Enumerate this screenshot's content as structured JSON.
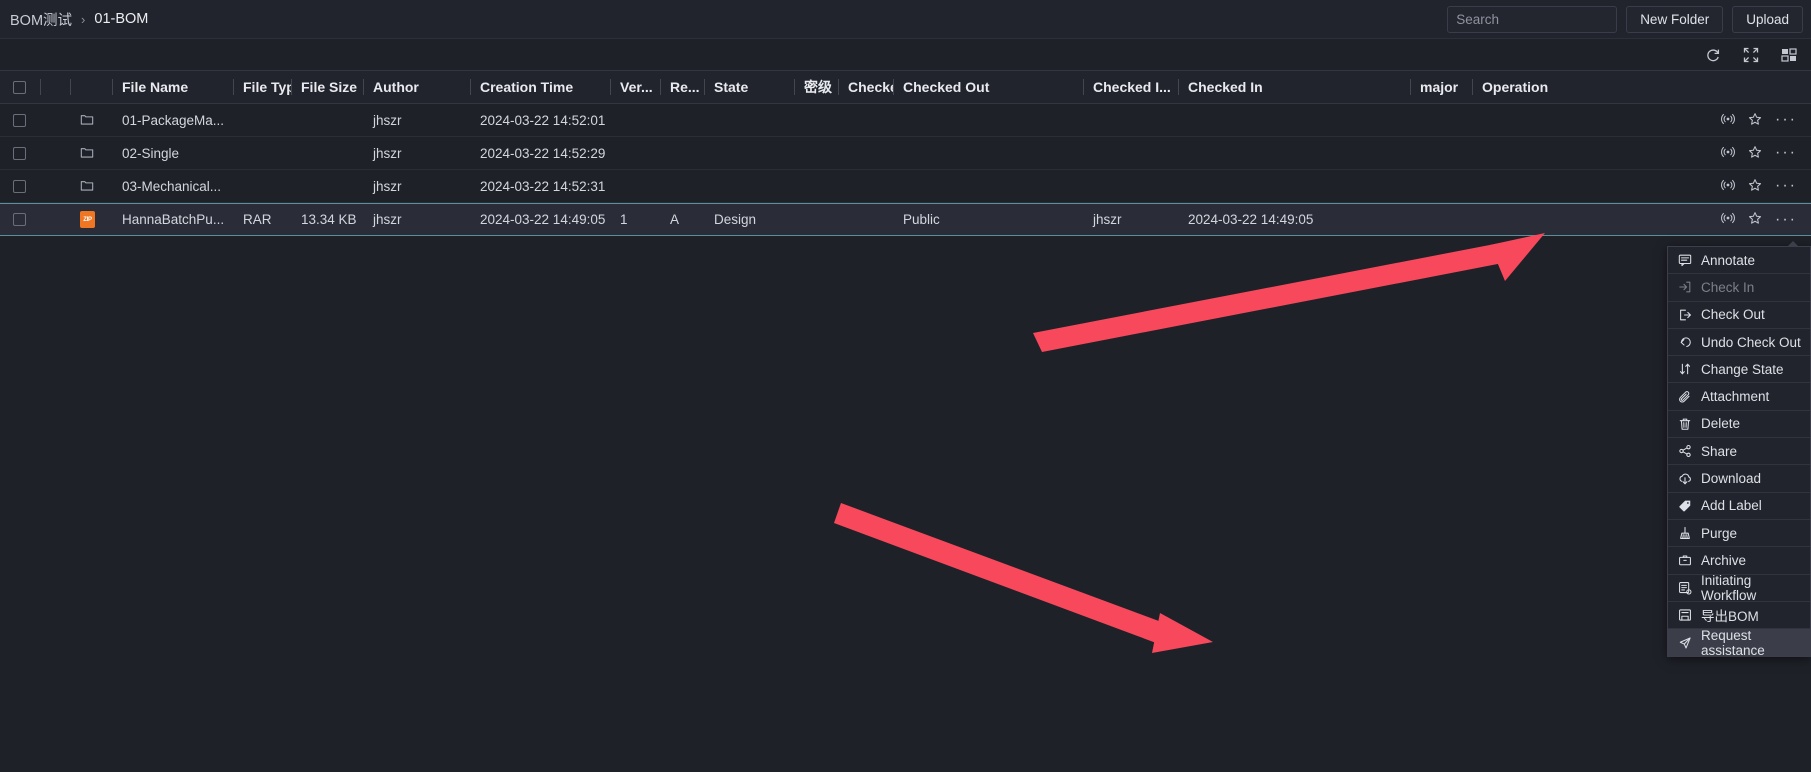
{
  "breadcrumb": {
    "root": "BOM测试",
    "separator": "›",
    "current": "01-BOM"
  },
  "toolbar": {
    "search_placeholder": "Search",
    "search_value": "",
    "new_folder_label": "New Folder",
    "upload_label": "Upload",
    "refresh_icon": "refresh-icon",
    "fullscreen_icon": "fullscreen-icon",
    "columns_icon": "columns-icon"
  },
  "table": {
    "headers": [
      {
        "key": "check",
        "label": ""
      },
      {
        "key": "tag",
        "label": ""
      },
      {
        "key": "icon",
        "label": ""
      },
      {
        "key": "name",
        "label": "File Name"
      },
      {
        "key": "type",
        "label": "File Type"
      },
      {
        "key": "size",
        "label": "File Size"
      },
      {
        "key": "author",
        "label": "Author"
      },
      {
        "key": "ctime",
        "label": "Creation Time"
      },
      {
        "key": "ver",
        "label": "Ver..."
      },
      {
        "key": "re",
        "label": "Re..."
      },
      {
        "key": "state",
        "label": "State"
      },
      {
        "key": "sec",
        "label": "密级"
      },
      {
        "key": "cko",
        "label": "Checke..."
      },
      {
        "key": "ckout",
        "label": "Checked Out"
      },
      {
        "key": "cki",
        "label": "Checked I..."
      },
      {
        "key": "ckin",
        "label": "Checked In"
      },
      {
        "key": "major",
        "label": "major"
      },
      {
        "key": "op",
        "label": "Operation"
      }
    ],
    "rows": [
      {
        "icon": "folder-icon",
        "name": "01-PackageMa...",
        "type": "",
        "size": "",
        "author": "jhszr",
        "ctime": "2024-03-22 14:52:01",
        "ver": "",
        "re": "",
        "state": "",
        "sec": "",
        "cko": "",
        "ckout": "",
        "cki": "",
        "ckin": "",
        "major": "",
        "selected": false
      },
      {
        "icon": "folder-icon",
        "name": "02-Single",
        "type": "",
        "size": "",
        "author": "jhszr",
        "ctime": "2024-03-22 14:52:29",
        "ver": "",
        "re": "",
        "state": "",
        "sec": "",
        "cko": "",
        "ckout": "",
        "cki": "",
        "ckin": "",
        "major": "",
        "selected": false
      },
      {
        "icon": "folder-icon",
        "name": "03-Mechanical...",
        "type": "",
        "size": "",
        "author": "jhszr",
        "ctime": "2024-03-22 14:52:31",
        "ver": "",
        "re": "",
        "state": "",
        "sec": "",
        "cko": "",
        "ckout": "",
        "cki": "",
        "ckin": "",
        "major": "",
        "selected": false
      },
      {
        "icon": "zip-file-icon",
        "icon_label": "ZIP",
        "name": "HannaBatchPu...",
        "type": "RAR",
        "size": "13.34 KB",
        "author": "jhszr",
        "ctime": "2024-03-22 14:49:05",
        "ver": "1",
        "re": "A",
        "state": "Design",
        "sec": "",
        "cko": "",
        "ckout": "Public",
        "cki": "jhszr",
        "ckin": "2024-03-22 14:49:05",
        "major": "",
        "selected": true
      }
    ],
    "row_actions": {
      "broadcast_icon": "broadcast-icon",
      "star_icon": "star-icon",
      "more_label": "···"
    }
  },
  "context_menu": {
    "items": [
      {
        "label": "Annotate",
        "icon": "annotate-icon",
        "disabled": false,
        "highlight": false
      },
      {
        "label": "Check In",
        "icon": "check-in-icon",
        "disabled": true,
        "highlight": false
      },
      {
        "label": "Check Out",
        "icon": "check-out-icon",
        "disabled": false,
        "highlight": false
      },
      {
        "label": "Undo Check Out",
        "icon": "undo-icon",
        "disabled": false,
        "highlight": false
      },
      {
        "label": "Change State",
        "icon": "swap-icon",
        "disabled": false,
        "highlight": false
      },
      {
        "label": "Attachment",
        "icon": "paperclip-icon",
        "disabled": false,
        "highlight": false
      },
      {
        "label": "Delete",
        "icon": "trash-icon",
        "disabled": false,
        "highlight": false
      },
      {
        "label": "Share",
        "icon": "share-icon",
        "disabled": false,
        "highlight": false
      },
      {
        "label": "Download",
        "icon": "download-icon",
        "disabled": false,
        "highlight": false
      },
      {
        "label": "Add Label",
        "icon": "tag-icon",
        "disabled": false,
        "highlight": false
      },
      {
        "label": "Purge",
        "icon": "broom-icon",
        "disabled": false,
        "highlight": false
      },
      {
        "label": "Archive",
        "icon": "archive-icon",
        "disabled": false,
        "highlight": false
      },
      {
        "label": "Initiating Workflow",
        "icon": "workflow-icon",
        "disabled": false,
        "highlight": false
      },
      {
        "label": "导出BOM",
        "icon": "export-icon",
        "disabled": false,
        "highlight": false
      },
      {
        "label": "Request assistance",
        "icon": "assist-icon",
        "disabled": false,
        "highlight": true
      }
    ]
  },
  "colors": {
    "background": "#1f2129",
    "panel": "#22242d",
    "accent": "#5a8f9c",
    "zip_icon": "#ef7622",
    "arrow": "#f7495b"
  }
}
